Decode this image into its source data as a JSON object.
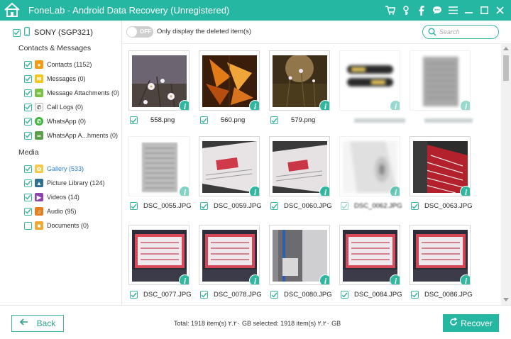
{
  "app": {
    "title": "FoneLab - Android Data Recovery (Unregistered)",
    "accent": "#26b7a3"
  },
  "titlebar_icons": [
    "cart-icon",
    "key-icon",
    "facebook-icon",
    "chat-icon",
    "menu-icon",
    "minimize-icon",
    "maximize-icon",
    "close-icon"
  ],
  "sidebar": {
    "device": "SONY (SGP321)",
    "sections": [
      {
        "title": "Contacts & Messages",
        "items": [
          {
            "label": "Contacts (1152)",
            "checked": true,
            "icon": "contacts-icon"
          },
          {
            "label": "Messages (0)",
            "checked": true,
            "icon": "messages-icon"
          },
          {
            "label": "Message Attachments (0)",
            "checked": true,
            "icon": "attachment-icon"
          },
          {
            "label": "Call Logs (0)",
            "checked": true,
            "icon": "call-log-icon"
          },
          {
            "label": "WhatsApp (0)",
            "checked": true,
            "icon": "whatsapp-icon"
          },
          {
            "label": "WhatsApp A...hments (0)",
            "checked": true,
            "icon": "whatsapp-attachment-icon"
          }
        ]
      },
      {
        "title": "Media",
        "items": [
          {
            "label": "Gallery (533)",
            "checked": true,
            "icon": "gallery-icon",
            "active": true
          },
          {
            "label": "Picture Library (124)",
            "checked": true,
            "icon": "picture-library-icon"
          },
          {
            "label": "Videos (14)",
            "checked": true,
            "icon": "videos-icon"
          },
          {
            "label": "Audio (95)",
            "checked": true,
            "icon": "audio-icon"
          },
          {
            "label": "Documents (0)",
            "checked": false,
            "icon": "documents-icon"
          }
        ]
      }
    ]
  },
  "toolbar": {
    "toggle_state": "OFF",
    "toggle_label": "Only display the deleted item(s)",
    "search_placeholder": "Search"
  },
  "files": [
    {
      "name": "558.png",
      "checked": true,
      "thumb": "flowers-dark"
    },
    {
      "name": "560.png",
      "checked": true,
      "thumb": "autumn-leaves"
    },
    {
      "name": "579.png",
      "checked": true,
      "thumb": "flower-field"
    },
    {
      "name": "",
      "checked": true,
      "thumb": "blurred-object",
      "blurred": true
    },
    {
      "name": "",
      "checked": true,
      "thumb": "blurred-document",
      "blurred": true
    },
    {
      "name": "DSC_0055.JPG",
      "checked": true,
      "thumb": "document-photo"
    },
    {
      "name": "DSC_0059.JPG",
      "checked": true,
      "thumb": "screen-photo"
    },
    {
      "name": "DSC_0060.JPG",
      "checked": true,
      "thumb": "screen-photo"
    },
    {
      "name": "DSC_0062.JPG",
      "checked": true,
      "thumb": "blurred-screen",
      "blurred": true
    },
    {
      "name": "DSC_0063.JPG",
      "checked": true,
      "thumb": "red-board"
    },
    {
      "name": "DSC_0077.JPG",
      "checked": true,
      "thumb": "laptop-screen"
    },
    {
      "name": "DSC_0078.JPG",
      "checked": true,
      "thumb": "laptop-screen"
    },
    {
      "name": "DSC_0080.JPG",
      "checked": true,
      "thumb": "window-photo"
    },
    {
      "name": "DSC_0084.JPG",
      "checked": true,
      "thumb": "laptop-screen"
    },
    {
      "name": "DSC_0086.JPG",
      "checked": true,
      "thumb": "laptop-screen"
    }
  ],
  "footer": {
    "back_label": "Back",
    "totals": "Total: 1918 item(s) ٢.٢٠ GB  selected: 1918 item(s) ٢.٢٠ GB",
    "recover_label": "Recover"
  }
}
